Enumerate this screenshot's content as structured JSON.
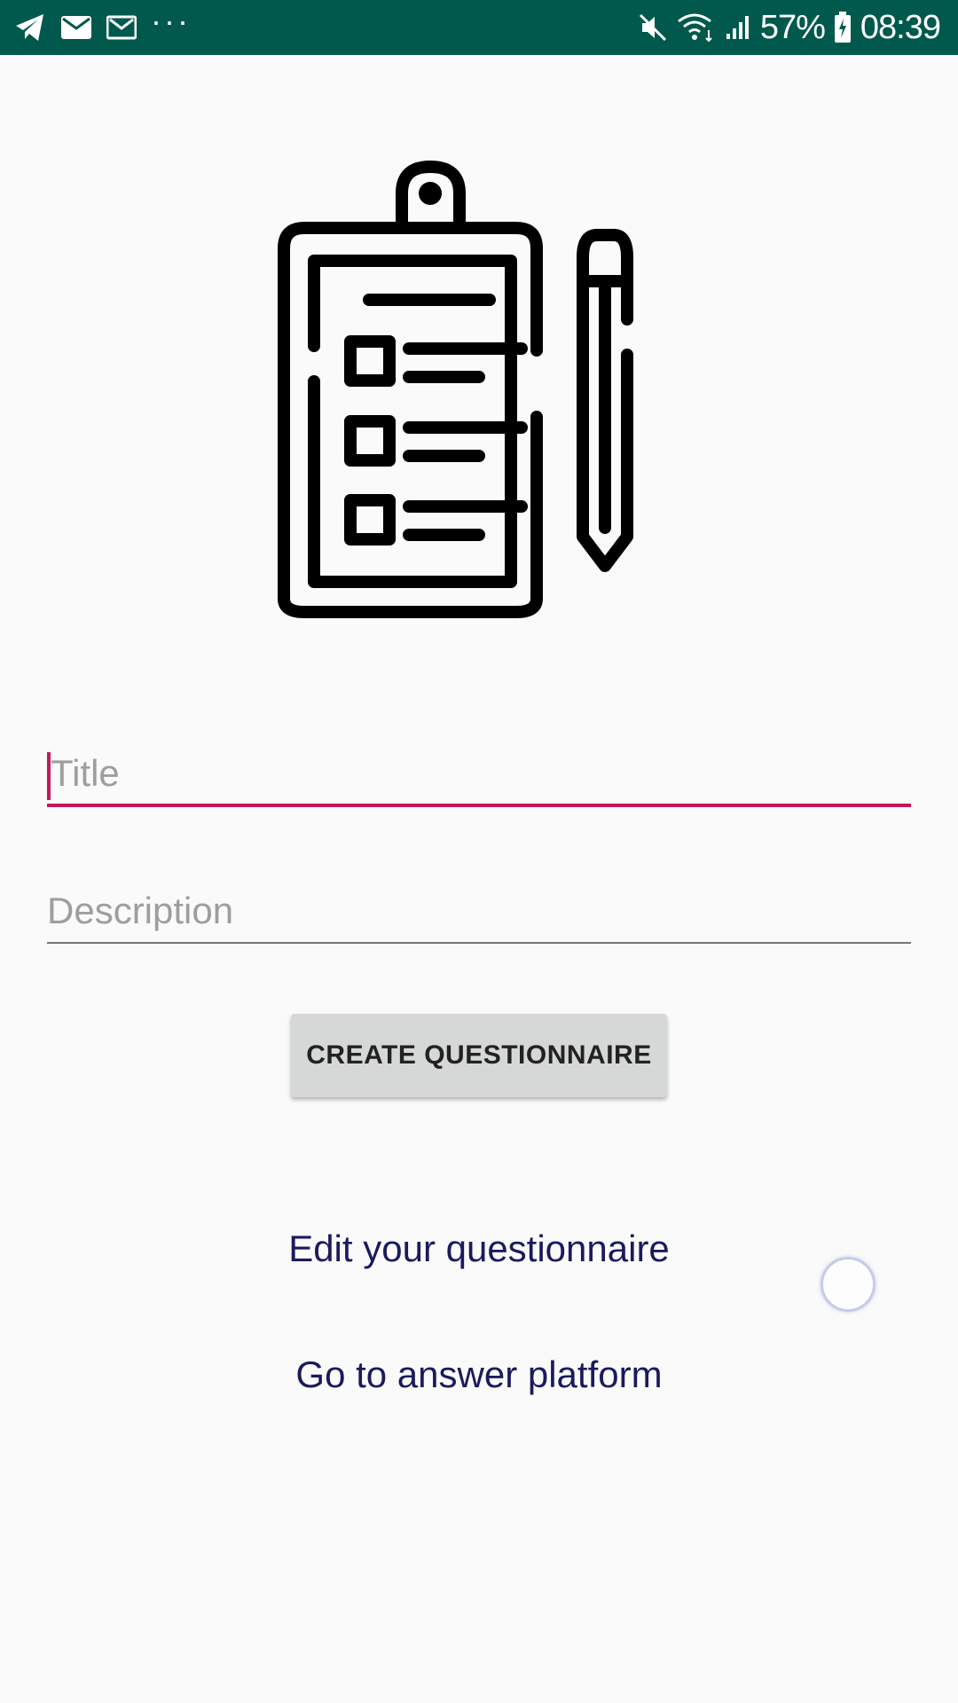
{
  "status_bar": {
    "battery_percent": "57%",
    "time": "08:39",
    "background_color": "#00594c",
    "left_icons": [
      "telegram-icon",
      "mail-icon",
      "gmail-icon",
      "more-notifications-icon"
    ],
    "right_icons": [
      "mute-icon",
      "wifi-icon",
      "signal-icon",
      "battery-icon"
    ],
    "more_label": "···"
  },
  "hero": {
    "icon": "clipboard-checklist-pencil-icon"
  },
  "form": {
    "title_placeholder": "Title",
    "title_value": "",
    "description_placeholder": "Description",
    "description_value": "",
    "accent_color": "#c2185b"
  },
  "actions": {
    "create_button_label": "CREATE QUESTIONNAIRE",
    "edit_link_label": "Edit your questionnaire",
    "answer_link_label": "Go to answer platform",
    "link_color": "#1a1a5e"
  }
}
